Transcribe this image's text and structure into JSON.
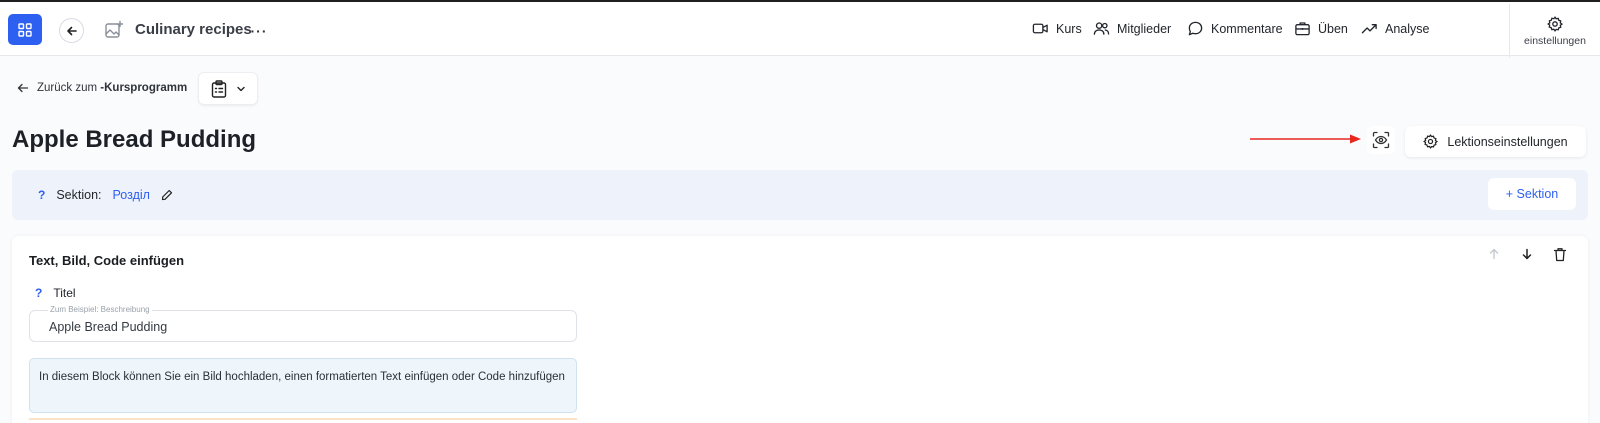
{
  "header": {
    "course_title": "Culinary recipes",
    "nav": [
      {
        "label": "Kurs",
        "icon": "video-icon"
      },
      {
        "label": "Mitglieder",
        "icon": "users-icon"
      },
      {
        "label": "Kommentare",
        "icon": "comment-icon"
      },
      {
        "label": "Üben",
        "icon": "briefcase-icon"
      },
      {
        "label": "Analyse",
        "icon": "trend-icon"
      }
    ],
    "settings_label": "einstellungen"
  },
  "breadcrumb": {
    "prefix": "Zurück zum",
    "target": "-Kursprogramm"
  },
  "page": {
    "title": "Apple Bread Pudding",
    "lesson_settings_label": "Lektionseinstellungen"
  },
  "section": {
    "help": "?",
    "label": "Sektion:",
    "name": "Розділ",
    "add_label": "+ Sektion"
  },
  "block": {
    "title": "Text, Bild, Code einfügen",
    "field_help": "?",
    "field_label": "Titel",
    "field_placeholder": "Zum Beispiel: Beschreibung",
    "field_value": "Apple Bread Pudding",
    "info_text": "In diesem Block können Sie ein Bild hochladen, einen formatierten Text einfügen oder Code hinzufügen"
  },
  "colors": {
    "accent": "#2d5ff0",
    "annotation_arrow": "#e8281e",
    "section_bg": "#eef3fb",
    "info_bg": "#eef6fb"
  }
}
